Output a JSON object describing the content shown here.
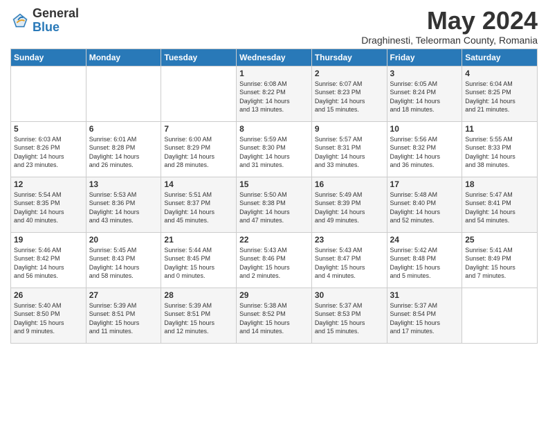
{
  "logo": {
    "general": "General",
    "blue": "Blue"
  },
  "title": "May 2024",
  "subtitle": "Draghinesti, Teleorman County, Romania",
  "days_of_week": [
    "Sunday",
    "Monday",
    "Tuesday",
    "Wednesday",
    "Thursday",
    "Friday",
    "Saturday"
  ],
  "weeks": [
    [
      {
        "day": "",
        "content": ""
      },
      {
        "day": "",
        "content": ""
      },
      {
        "day": "",
        "content": ""
      },
      {
        "day": "1",
        "content": "Sunrise: 6:08 AM\nSunset: 8:22 PM\nDaylight: 14 hours\nand 13 minutes."
      },
      {
        "day": "2",
        "content": "Sunrise: 6:07 AM\nSunset: 8:23 PM\nDaylight: 14 hours\nand 15 minutes."
      },
      {
        "day": "3",
        "content": "Sunrise: 6:05 AM\nSunset: 8:24 PM\nDaylight: 14 hours\nand 18 minutes."
      },
      {
        "day": "4",
        "content": "Sunrise: 6:04 AM\nSunset: 8:25 PM\nDaylight: 14 hours\nand 21 minutes."
      }
    ],
    [
      {
        "day": "5",
        "content": "Sunrise: 6:03 AM\nSunset: 8:26 PM\nDaylight: 14 hours\nand 23 minutes."
      },
      {
        "day": "6",
        "content": "Sunrise: 6:01 AM\nSunset: 8:28 PM\nDaylight: 14 hours\nand 26 minutes."
      },
      {
        "day": "7",
        "content": "Sunrise: 6:00 AM\nSunset: 8:29 PM\nDaylight: 14 hours\nand 28 minutes."
      },
      {
        "day": "8",
        "content": "Sunrise: 5:59 AM\nSunset: 8:30 PM\nDaylight: 14 hours\nand 31 minutes."
      },
      {
        "day": "9",
        "content": "Sunrise: 5:57 AM\nSunset: 8:31 PM\nDaylight: 14 hours\nand 33 minutes."
      },
      {
        "day": "10",
        "content": "Sunrise: 5:56 AM\nSunset: 8:32 PM\nDaylight: 14 hours\nand 36 minutes."
      },
      {
        "day": "11",
        "content": "Sunrise: 5:55 AM\nSunset: 8:33 PM\nDaylight: 14 hours\nand 38 minutes."
      }
    ],
    [
      {
        "day": "12",
        "content": "Sunrise: 5:54 AM\nSunset: 8:35 PM\nDaylight: 14 hours\nand 40 minutes."
      },
      {
        "day": "13",
        "content": "Sunrise: 5:53 AM\nSunset: 8:36 PM\nDaylight: 14 hours\nand 43 minutes."
      },
      {
        "day": "14",
        "content": "Sunrise: 5:51 AM\nSunset: 8:37 PM\nDaylight: 14 hours\nand 45 minutes."
      },
      {
        "day": "15",
        "content": "Sunrise: 5:50 AM\nSunset: 8:38 PM\nDaylight: 14 hours\nand 47 minutes."
      },
      {
        "day": "16",
        "content": "Sunrise: 5:49 AM\nSunset: 8:39 PM\nDaylight: 14 hours\nand 49 minutes."
      },
      {
        "day": "17",
        "content": "Sunrise: 5:48 AM\nSunset: 8:40 PM\nDaylight: 14 hours\nand 52 minutes."
      },
      {
        "day": "18",
        "content": "Sunrise: 5:47 AM\nSunset: 8:41 PM\nDaylight: 14 hours\nand 54 minutes."
      }
    ],
    [
      {
        "day": "19",
        "content": "Sunrise: 5:46 AM\nSunset: 8:42 PM\nDaylight: 14 hours\nand 56 minutes."
      },
      {
        "day": "20",
        "content": "Sunrise: 5:45 AM\nSunset: 8:43 PM\nDaylight: 14 hours\nand 58 minutes."
      },
      {
        "day": "21",
        "content": "Sunrise: 5:44 AM\nSunset: 8:45 PM\nDaylight: 15 hours\nand 0 minutes."
      },
      {
        "day": "22",
        "content": "Sunrise: 5:43 AM\nSunset: 8:46 PM\nDaylight: 15 hours\nand 2 minutes."
      },
      {
        "day": "23",
        "content": "Sunrise: 5:43 AM\nSunset: 8:47 PM\nDaylight: 15 hours\nand 4 minutes."
      },
      {
        "day": "24",
        "content": "Sunrise: 5:42 AM\nSunset: 8:48 PM\nDaylight: 15 hours\nand 5 minutes."
      },
      {
        "day": "25",
        "content": "Sunrise: 5:41 AM\nSunset: 8:49 PM\nDaylight: 15 hours\nand 7 minutes."
      }
    ],
    [
      {
        "day": "26",
        "content": "Sunrise: 5:40 AM\nSunset: 8:50 PM\nDaylight: 15 hours\nand 9 minutes."
      },
      {
        "day": "27",
        "content": "Sunrise: 5:39 AM\nSunset: 8:51 PM\nDaylight: 15 hours\nand 11 minutes."
      },
      {
        "day": "28",
        "content": "Sunrise: 5:39 AM\nSunset: 8:51 PM\nDaylight: 15 hours\nand 12 minutes."
      },
      {
        "day": "29",
        "content": "Sunrise: 5:38 AM\nSunset: 8:52 PM\nDaylight: 15 hours\nand 14 minutes."
      },
      {
        "day": "30",
        "content": "Sunrise: 5:37 AM\nSunset: 8:53 PM\nDaylight: 15 hours\nand 15 minutes."
      },
      {
        "day": "31",
        "content": "Sunrise: 5:37 AM\nSunset: 8:54 PM\nDaylight: 15 hours\nand 17 minutes."
      },
      {
        "day": "",
        "content": ""
      }
    ]
  ]
}
